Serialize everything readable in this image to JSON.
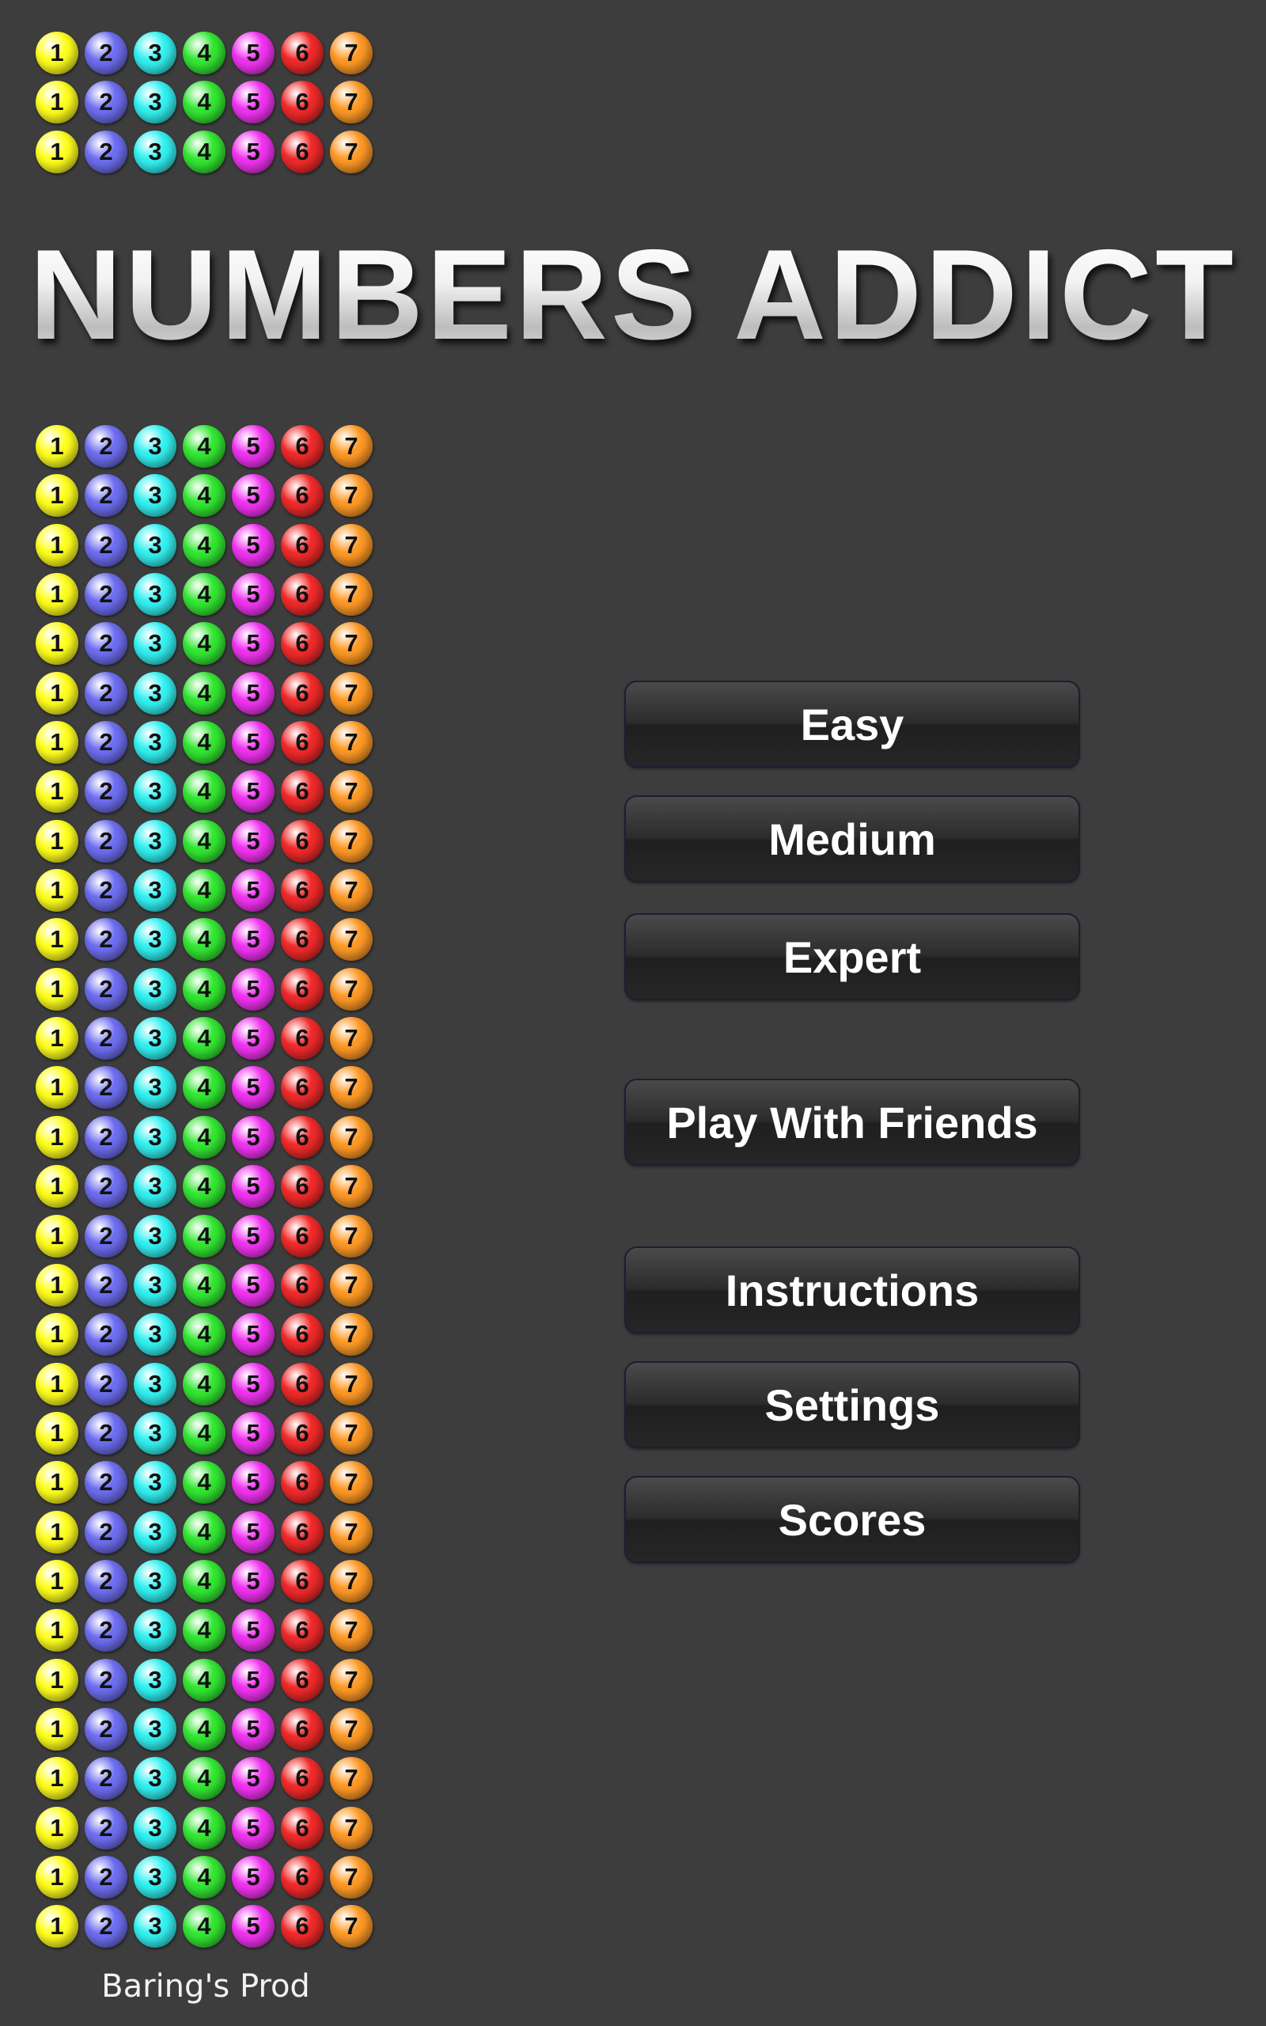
{
  "title": "NUMBERS ADDICT",
  "ball_numbers": [
    "1",
    "2",
    "3",
    "4",
    "5",
    "6",
    "7"
  ],
  "ball_colors": [
    "#ffff1e",
    "#6f6ff2",
    "#33f2f2",
    "#33e833",
    "#f233f2",
    "#f22a2a",
    "#ff9a26"
  ],
  "top_grid_rows": 3,
  "main_grid_rows": 31,
  "menu": {
    "easy": "Easy",
    "medium": "Medium",
    "expert": "Expert",
    "play_with_friends": "Play With Friends",
    "instructions": "Instructions",
    "settings": "Settings",
    "scores": "Scores"
  },
  "credit": "Baring's Prod"
}
